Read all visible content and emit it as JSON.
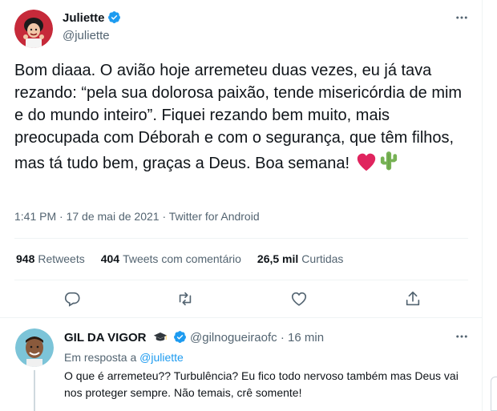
{
  "tweet": {
    "name": "Juliette",
    "handle": "@juliette",
    "text": "Bom diaaa. O avião hoje arremeteu duas vezes, eu já tava rezando: “pela sua dolorosa paixão, tende misericórdia de mim e do mundo inteiro”. Fiquei rezando bem muito, mais preocupada com Déborah e com o segurança, que têm filhos, mas tá tudo bem, graças a Deus. Boa semana! ",
    "emojis": [
      "red-heart",
      "cactus"
    ],
    "time": "1:41 PM",
    "date": "17 de mai de 2021",
    "source": "Twitter for Android",
    "separator": "·"
  },
  "stats": {
    "retweets_count": "948",
    "retweets_label": "Retweets",
    "quotes_count": "404",
    "quotes_label": "Tweets com comentário",
    "likes_count": "26,5 mil",
    "likes_label": "Curtidas"
  },
  "actions": [
    "reply-icon",
    "retweet-icon",
    "like-icon",
    "share-icon"
  ],
  "reply": {
    "name": "GIL DA VIGOR",
    "badge_emoji": "graduation-cap",
    "handle": "@gilnogueiraofc",
    "separator": "·",
    "time": "16 min",
    "reply_to_prefix": "Em resposta a",
    "reply_to_handle": "@juliette",
    "text": "O que é arremeteu?? Turbulência? Eu fico todo nervoso também mas Deus vai nos proteger sempre. Não temais, crê somente!"
  },
  "colors": {
    "accent": "#1d9bf0",
    "secondary_text": "#536471",
    "heart": "#e0245e",
    "cactus": "#77b255"
  }
}
